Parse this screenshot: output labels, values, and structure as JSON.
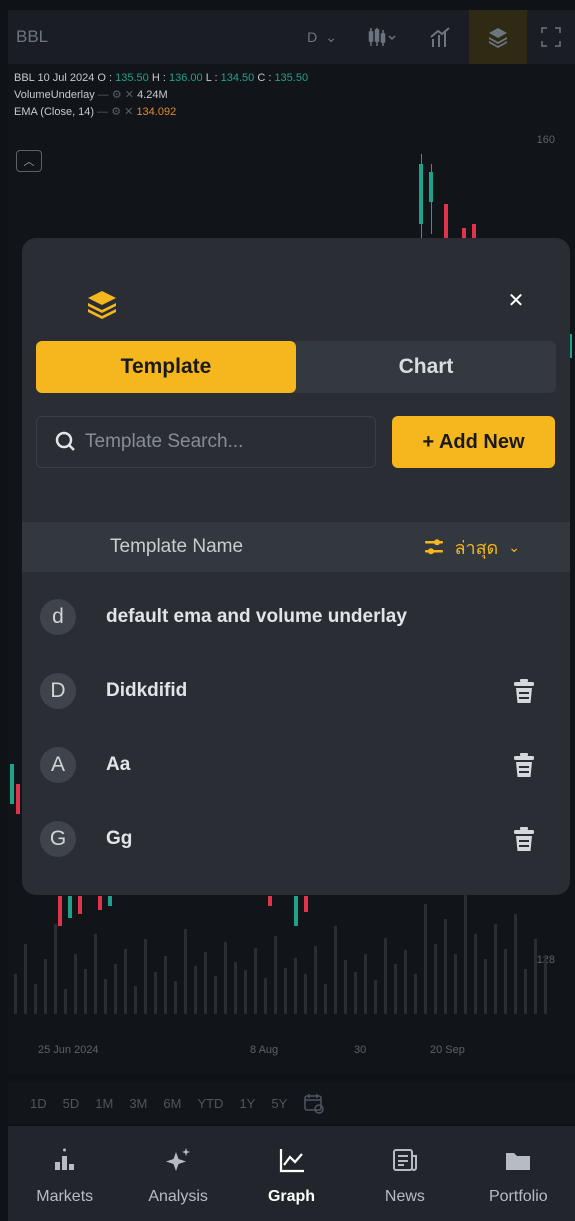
{
  "topbar": {
    "symbol": "BBL",
    "interval": "D"
  },
  "legend": {
    "line1": {
      "symbol": "BBL",
      "date": "10 Jul 2024",
      "o_label": "O :",
      "o": "135.50",
      "h_label": "H :",
      "h": "136.00",
      "l_label": "L :",
      "l": "134.50",
      "c_label": "C :",
      "c": "135.50"
    },
    "line2": {
      "name": "VolumeUnderlay",
      "value": "4.24M"
    },
    "line3": {
      "name": "EMA (Close, 14)",
      "value": "134.092"
    }
  },
  "chart": {
    "y_ticks": [
      "160",
      "128"
    ],
    "x_ticks": [
      "25 Jun 2024",
      "8 Aug",
      "30",
      "20 Sep"
    ]
  },
  "ranges": [
    "1D",
    "5D",
    "1M",
    "3M",
    "6M",
    "YTD",
    "1Y",
    "5Y"
  ],
  "modal": {
    "tabs": {
      "template": "Template",
      "chart": "Chart"
    },
    "active_tab": "Template",
    "search_placeholder": "Template Search...",
    "add_new": "+ Add New",
    "table_header": "Template Name",
    "sort_label": "ล่าสุด",
    "templates": [
      {
        "initial": "d",
        "name": "default ema and volume underlay",
        "deletable": false
      },
      {
        "initial": "D",
        "name": "Didkdifid",
        "deletable": true
      },
      {
        "initial": "A",
        "name": "Aa",
        "deletable": true
      },
      {
        "initial": "G",
        "name": "Gg",
        "deletable": true
      }
    ]
  },
  "nav": {
    "items": [
      "Markets",
      "Analysis",
      "Graph",
      "News",
      "Portfolio"
    ],
    "active": "Graph"
  },
  "colors": {
    "accent": "#f5b71d",
    "modal_bg": "#2a2e34",
    "up": "#1fa28a",
    "down": "#e0344a"
  }
}
